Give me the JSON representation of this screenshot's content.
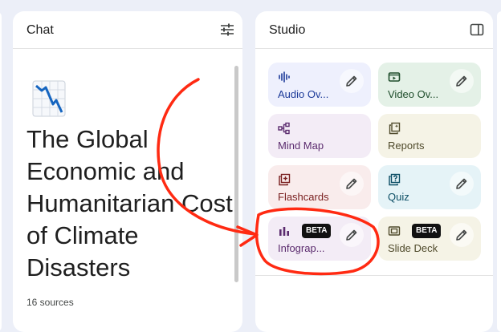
{
  "chat": {
    "title": "Chat",
    "notebook_title": "The Global Economic and Humanitarian Cost of Climate Disasters",
    "sources_count": "16 sources"
  },
  "studio": {
    "title": "Studio",
    "tiles": [
      {
        "label": "Audio Ov...",
        "icon": "audio-waveform-icon",
        "bg": "#eef0fd",
        "fg": "#1c3a99",
        "editable": true,
        "beta": false
      },
      {
        "label": "Video Ov...",
        "icon": "video-icon",
        "bg": "#e4f1e7",
        "fg": "#1e4d2b",
        "editable": true,
        "beta": false
      },
      {
        "label": "Mind Map",
        "icon": "mind-map-icon",
        "bg": "#f3ecf6",
        "fg": "#5b2b6e",
        "editable": false,
        "beta": false
      },
      {
        "label": "Reports",
        "icon": "reports-icon",
        "bg": "#f5f3e6",
        "fg": "#4f4a2b",
        "editable": false,
        "beta": false
      },
      {
        "label": "Flashcards",
        "icon": "flashcards-icon",
        "bg": "#f9ecec",
        "fg": "#7a2020",
        "editable": true,
        "beta": false
      },
      {
        "label": "Quiz",
        "icon": "quiz-icon",
        "bg": "#e5f3f7",
        "fg": "#0d4f66",
        "editable": true,
        "beta": false
      },
      {
        "label": "Infograp...",
        "icon": "infographic-icon",
        "bg": "#f3ecf6",
        "fg": "#5b2b6e",
        "editable": true,
        "beta": true
      },
      {
        "label": "Slide Deck",
        "icon": "slide-deck-icon",
        "bg": "#f5f3e6",
        "fg": "#4f4a2b",
        "editable": true,
        "beta": true
      }
    ],
    "beta_label": "BETA"
  },
  "annotation_color": "#ff2a12"
}
